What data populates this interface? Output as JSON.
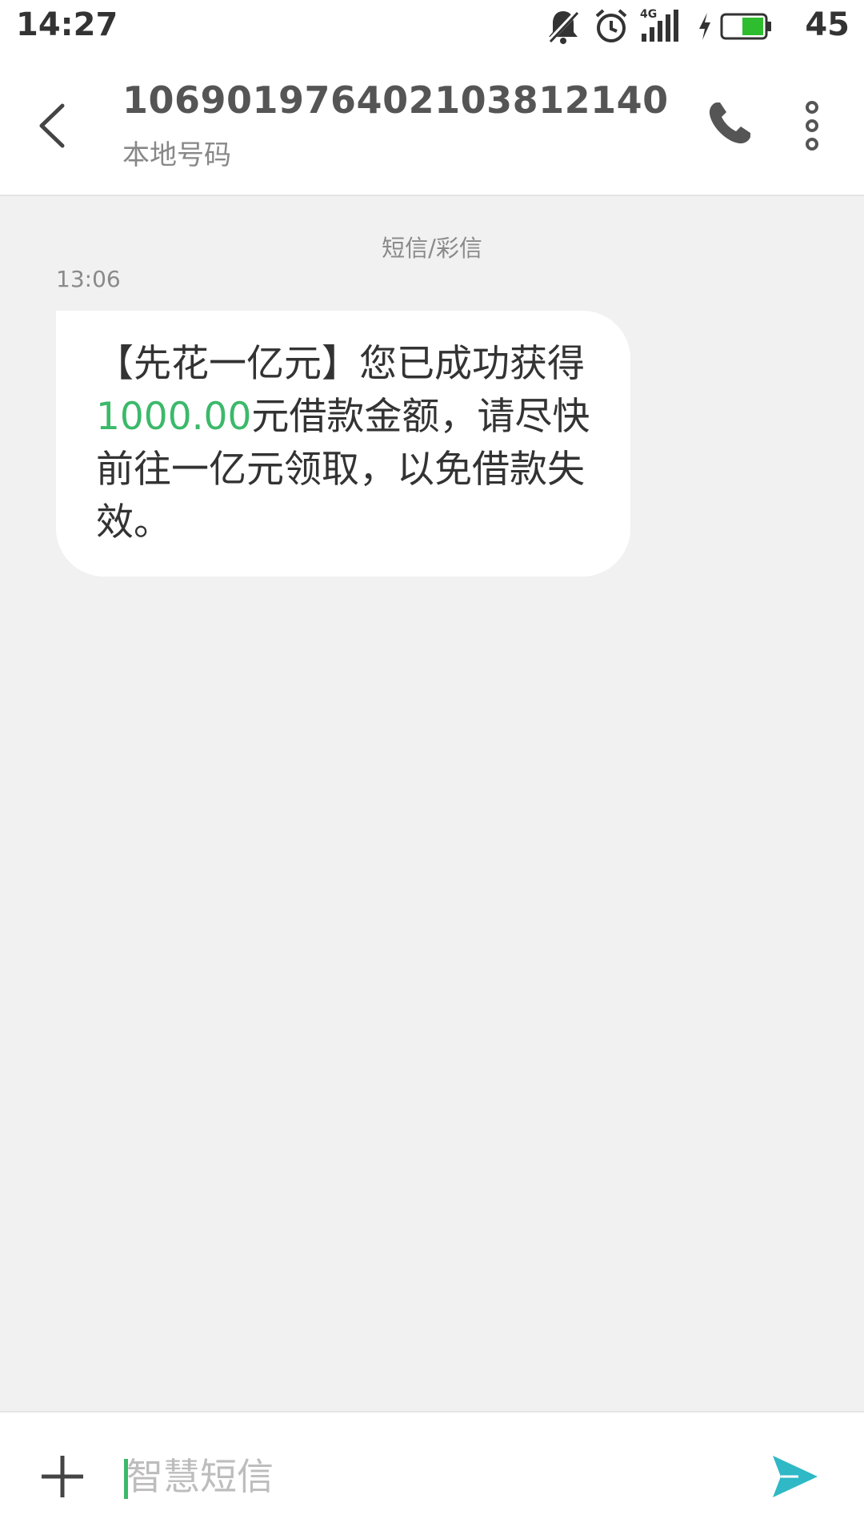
{
  "status_bar": {
    "time": "14:27",
    "network": "4G",
    "battery": "45",
    "icons": [
      "mute-bell-icon",
      "alarm-icon",
      "signal-icon",
      "charging-icon",
      "battery-icon"
    ]
  },
  "header": {
    "contact_number": "106901976402103812140",
    "contact_sub": "本地号码",
    "icons": [
      "back-arrow-icon",
      "phone-icon",
      "more-vert-icon"
    ]
  },
  "conversation": {
    "section_label": "短信/彩信",
    "message": {
      "time": "13:06",
      "text_before": "【先花一亿元】您已成功获得",
      "amount": "1000.00",
      "text_after": "元借款金额，请尽快前往一亿元领取，以免借款失效。"
    }
  },
  "composer": {
    "placeholder": "智慧短信",
    "icons": [
      "plus-icon",
      "send-icon"
    ]
  },
  "colors": {
    "accent_green": "#3bb96a",
    "send_teal": "#2fb8c6",
    "background": "#f1f1f1"
  }
}
